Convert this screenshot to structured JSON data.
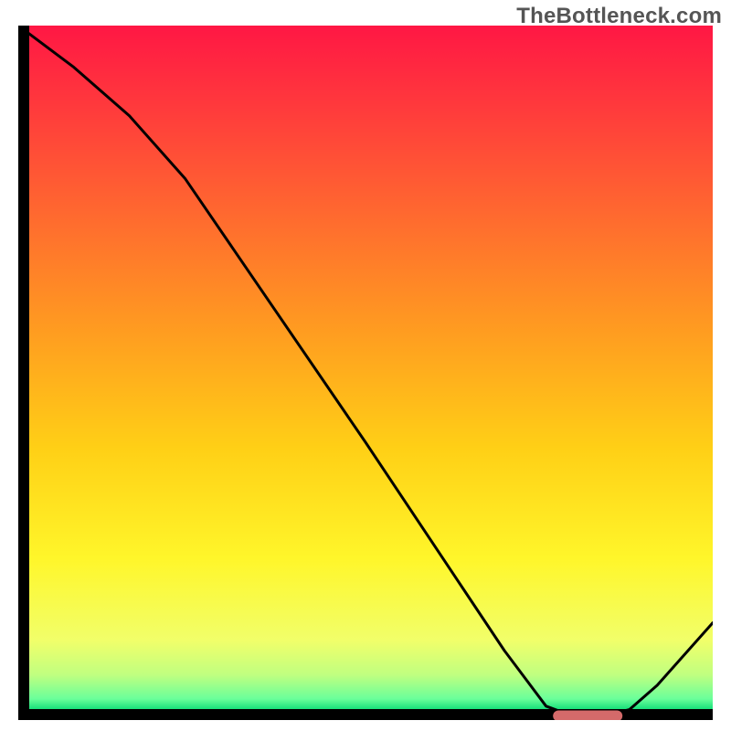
{
  "watermark": "TheBottleneck.com",
  "chart_data": {
    "type": "line",
    "title": "",
    "xlabel": "",
    "ylabel": "",
    "xlim": [
      0,
      100
    ],
    "ylim": [
      0,
      100
    ],
    "series": [
      {
        "name": "curve",
        "x": [
          0,
          8,
          16,
          24,
          50,
          70,
          76,
          80,
          84,
          88,
          92,
          100
        ],
        "y": [
          100,
          94,
          87,
          78,
          40,
          10,
          2,
          0.5,
          0.5,
          1.5,
          5,
          14
        ]
      }
    ],
    "marker": {
      "name": "optimum-band",
      "x_start": 77,
      "x_end": 87,
      "y": 0.6,
      "color": "#d46a6a"
    },
    "background_gradient": {
      "stops": [
        {
          "offset": 0.0,
          "color": "#ff1744"
        },
        {
          "offset": 0.12,
          "color": "#ff3a3c"
        },
        {
          "offset": 0.28,
          "color": "#ff6a2f"
        },
        {
          "offset": 0.45,
          "color": "#ff9d20"
        },
        {
          "offset": 0.62,
          "color": "#ffd016"
        },
        {
          "offset": 0.78,
          "color": "#fff62a"
        },
        {
          "offset": 0.9,
          "color": "#f1ff6a"
        },
        {
          "offset": 0.95,
          "color": "#c0ff80"
        },
        {
          "offset": 0.985,
          "color": "#6aff9a"
        },
        {
          "offset": 1.0,
          "color": "#18e07a"
        }
      ]
    },
    "axis_color": "#000000",
    "line_color": "#000000",
    "line_width": 3
  }
}
